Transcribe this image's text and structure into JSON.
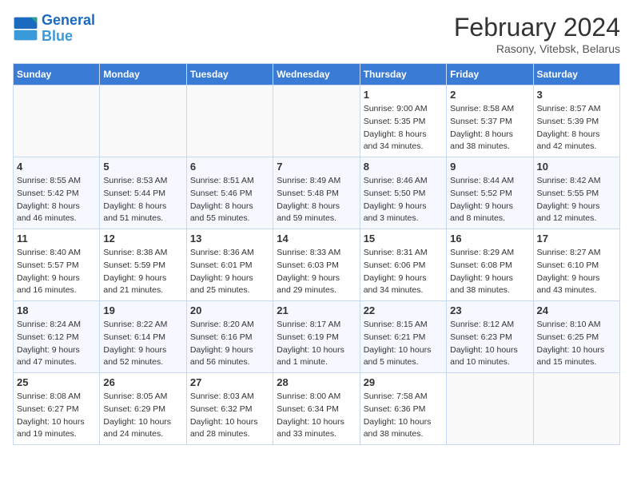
{
  "logo": {
    "line1": "General",
    "line2": "Blue"
  },
  "title": "February 2024",
  "location": "Rasony, Vitebsk, Belarus",
  "days_header": [
    "Sunday",
    "Monday",
    "Tuesday",
    "Wednesday",
    "Thursday",
    "Friday",
    "Saturday"
  ],
  "weeks": [
    [
      {
        "day": "",
        "info": ""
      },
      {
        "day": "",
        "info": ""
      },
      {
        "day": "",
        "info": ""
      },
      {
        "day": "",
        "info": ""
      },
      {
        "day": "1",
        "info": "Sunrise: 9:00 AM\nSunset: 5:35 PM\nDaylight: 8 hours\nand 34 minutes."
      },
      {
        "day": "2",
        "info": "Sunrise: 8:58 AM\nSunset: 5:37 PM\nDaylight: 8 hours\nand 38 minutes."
      },
      {
        "day": "3",
        "info": "Sunrise: 8:57 AM\nSunset: 5:39 PM\nDaylight: 8 hours\nand 42 minutes."
      }
    ],
    [
      {
        "day": "4",
        "info": "Sunrise: 8:55 AM\nSunset: 5:42 PM\nDaylight: 8 hours\nand 46 minutes."
      },
      {
        "day": "5",
        "info": "Sunrise: 8:53 AM\nSunset: 5:44 PM\nDaylight: 8 hours\nand 51 minutes."
      },
      {
        "day": "6",
        "info": "Sunrise: 8:51 AM\nSunset: 5:46 PM\nDaylight: 8 hours\nand 55 minutes."
      },
      {
        "day": "7",
        "info": "Sunrise: 8:49 AM\nSunset: 5:48 PM\nDaylight: 8 hours\nand 59 minutes."
      },
      {
        "day": "8",
        "info": "Sunrise: 8:46 AM\nSunset: 5:50 PM\nDaylight: 9 hours\nand 3 minutes."
      },
      {
        "day": "9",
        "info": "Sunrise: 8:44 AM\nSunset: 5:52 PM\nDaylight: 9 hours\nand 8 minutes."
      },
      {
        "day": "10",
        "info": "Sunrise: 8:42 AM\nSunset: 5:55 PM\nDaylight: 9 hours\nand 12 minutes."
      }
    ],
    [
      {
        "day": "11",
        "info": "Sunrise: 8:40 AM\nSunset: 5:57 PM\nDaylight: 9 hours\nand 16 minutes."
      },
      {
        "day": "12",
        "info": "Sunrise: 8:38 AM\nSunset: 5:59 PM\nDaylight: 9 hours\nand 21 minutes."
      },
      {
        "day": "13",
        "info": "Sunrise: 8:36 AM\nSunset: 6:01 PM\nDaylight: 9 hours\nand 25 minutes."
      },
      {
        "day": "14",
        "info": "Sunrise: 8:33 AM\nSunset: 6:03 PM\nDaylight: 9 hours\nand 29 minutes."
      },
      {
        "day": "15",
        "info": "Sunrise: 8:31 AM\nSunset: 6:06 PM\nDaylight: 9 hours\nand 34 minutes."
      },
      {
        "day": "16",
        "info": "Sunrise: 8:29 AM\nSunset: 6:08 PM\nDaylight: 9 hours\nand 38 minutes."
      },
      {
        "day": "17",
        "info": "Sunrise: 8:27 AM\nSunset: 6:10 PM\nDaylight: 9 hours\nand 43 minutes."
      }
    ],
    [
      {
        "day": "18",
        "info": "Sunrise: 8:24 AM\nSunset: 6:12 PM\nDaylight: 9 hours\nand 47 minutes."
      },
      {
        "day": "19",
        "info": "Sunrise: 8:22 AM\nSunset: 6:14 PM\nDaylight: 9 hours\nand 52 minutes."
      },
      {
        "day": "20",
        "info": "Sunrise: 8:20 AM\nSunset: 6:16 PM\nDaylight: 9 hours\nand 56 minutes."
      },
      {
        "day": "21",
        "info": "Sunrise: 8:17 AM\nSunset: 6:19 PM\nDaylight: 10 hours\nand 1 minute."
      },
      {
        "day": "22",
        "info": "Sunrise: 8:15 AM\nSunset: 6:21 PM\nDaylight: 10 hours\nand 5 minutes."
      },
      {
        "day": "23",
        "info": "Sunrise: 8:12 AM\nSunset: 6:23 PM\nDaylight: 10 hours\nand 10 minutes."
      },
      {
        "day": "24",
        "info": "Sunrise: 8:10 AM\nSunset: 6:25 PM\nDaylight: 10 hours\nand 15 minutes."
      }
    ],
    [
      {
        "day": "25",
        "info": "Sunrise: 8:08 AM\nSunset: 6:27 PM\nDaylight: 10 hours\nand 19 minutes."
      },
      {
        "day": "26",
        "info": "Sunrise: 8:05 AM\nSunset: 6:29 PM\nDaylight: 10 hours\nand 24 minutes."
      },
      {
        "day": "27",
        "info": "Sunrise: 8:03 AM\nSunset: 6:32 PM\nDaylight: 10 hours\nand 28 minutes."
      },
      {
        "day": "28",
        "info": "Sunrise: 8:00 AM\nSunset: 6:34 PM\nDaylight: 10 hours\nand 33 minutes."
      },
      {
        "day": "29",
        "info": "Sunrise: 7:58 AM\nSunset: 6:36 PM\nDaylight: 10 hours\nand 38 minutes."
      },
      {
        "day": "",
        "info": ""
      },
      {
        "day": "",
        "info": ""
      }
    ]
  ]
}
